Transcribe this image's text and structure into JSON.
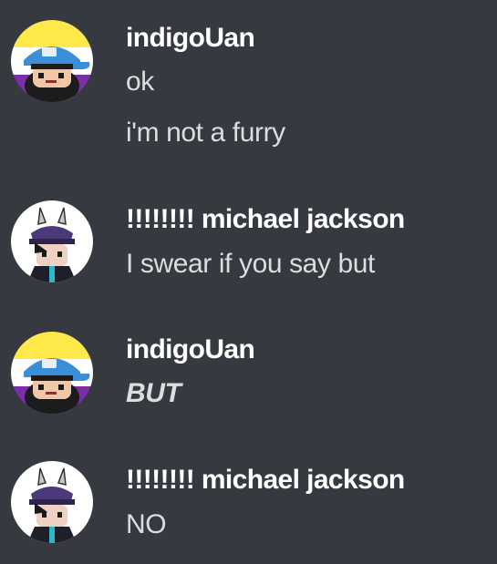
{
  "messages": [
    {
      "author": "indigoUan",
      "avatar_icon": "indigo-avatar-icon",
      "lines": [
        "ok",
        "i'm not a furry"
      ]
    },
    {
      "author": "!!!!!!!! michael jackson",
      "avatar_icon": "michael-avatar-icon",
      "lines": [
        "I swear if you say but"
      ]
    },
    {
      "author": "indigoUan",
      "avatar_icon": "indigo-avatar-icon",
      "lines": [
        "BUT"
      ]
    },
    {
      "author": "!!!!!!!! michael jackson",
      "avatar_icon": "michael-avatar-icon",
      "lines": [
        "NO"
      ]
    }
  ],
  "colors": {
    "background": "#36393f",
    "username": "#ffffff",
    "message_text": "#dcddde"
  }
}
